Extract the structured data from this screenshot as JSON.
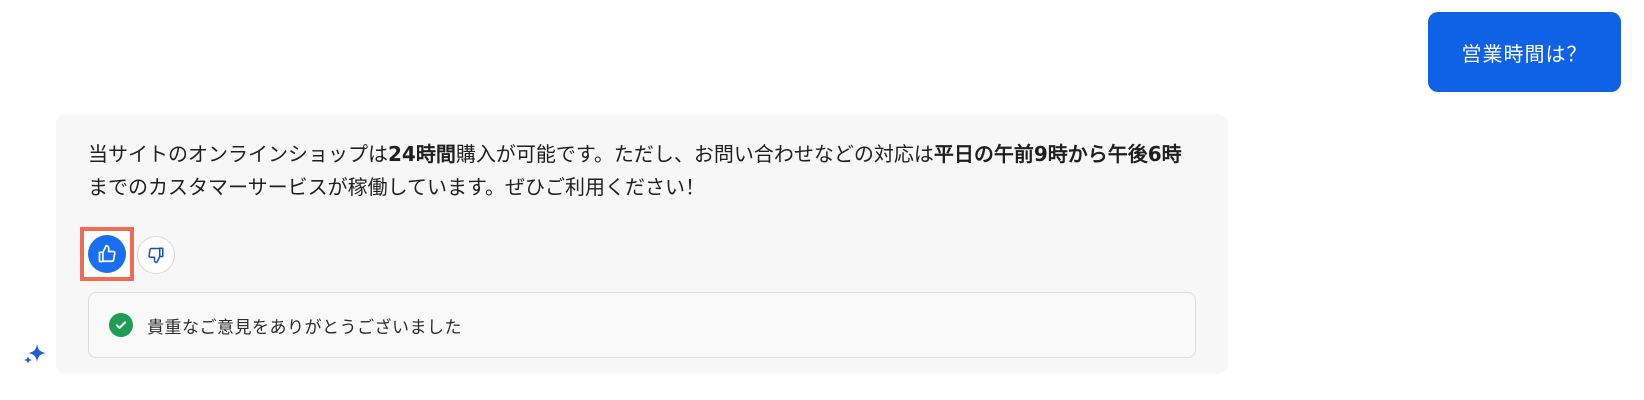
{
  "user_message": "営業時間は？",
  "bot_answer": {
    "segments": [
      {
        "text": "当サイトのオンラインショップは",
        "bold": false
      },
      {
        "text": "24時間",
        "bold": true
      },
      {
        "text": "購入が可能です。ただし、お問い合わせなどの対応は",
        "bold": false
      },
      {
        "text": "平日の午前9時から午後6時",
        "bold": true
      },
      {
        "text": "までのカスタマーサービスが稼働しています。ぜひご利用ください！",
        "bold": false
      }
    ]
  },
  "feedback": {
    "thanks_text": "貴重なご意見をありがとうございました",
    "selected": "thumbs-up"
  },
  "colors": {
    "accent": "#0f62e6",
    "thumb_active": "#1a6ff0",
    "highlight": "#ee6b55",
    "success": "#1f9d55"
  },
  "icons": [
    "thumbs-up-icon",
    "thumbs-down-icon",
    "check-circle-icon",
    "sparkle-icon"
  ]
}
